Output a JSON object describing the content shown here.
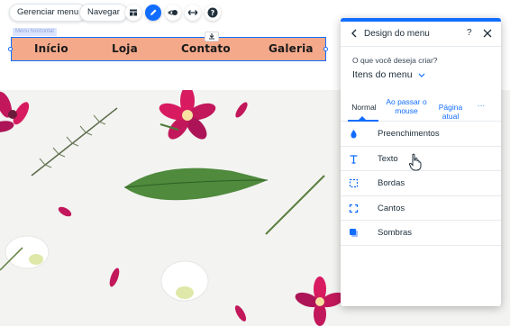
{
  "toolbar": {
    "manage_menu_label": "Gerenciar menu",
    "navigate_label": "Navegar",
    "icons": [
      "layout-icon",
      "design-pen-icon",
      "animation-icon",
      "stretch-icon",
      "help-icon"
    ]
  },
  "menu": {
    "tag_label": "Menu horizontal",
    "items": [
      "Início",
      "Loja",
      "Contato",
      "Galeria"
    ]
  },
  "panel": {
    "title": "Design do menu",
    "help_label": "?",
    "question": "O que você deseja criar?",
    "select_value": "Itens do menu",
    "tabs": [
      {
        "label": "Normal",
        "selected": true
      },
      {
        "label": "Ao passar o mouse",
        "selected": false
      },
      {
        "label": "Página atual",
        "selected": false
      },
      {
        "label": "···",
        "selected": false
      }
    ],
    "design_options": [
      {
        "label": "Preenchimentos",
        "icon": "fill-drop-icon"
      },
      {
        "label": "Texto",
        "icon": "text-icon"
      },
      {
        "label": "Bordas",
        "icon": "borders-icon"
      },
      {
        "label": "Cantos",
        "icon": "corners-icon"
      },
      {
        "label": "Sombras",
        "icon": "shadow-icon"
      }
    ]
  },
  "colors": {
    "accent": "#116dff",
    "menu_background": "#f4a98b",
    "flower_pink": "#c2185b"
  }
}
